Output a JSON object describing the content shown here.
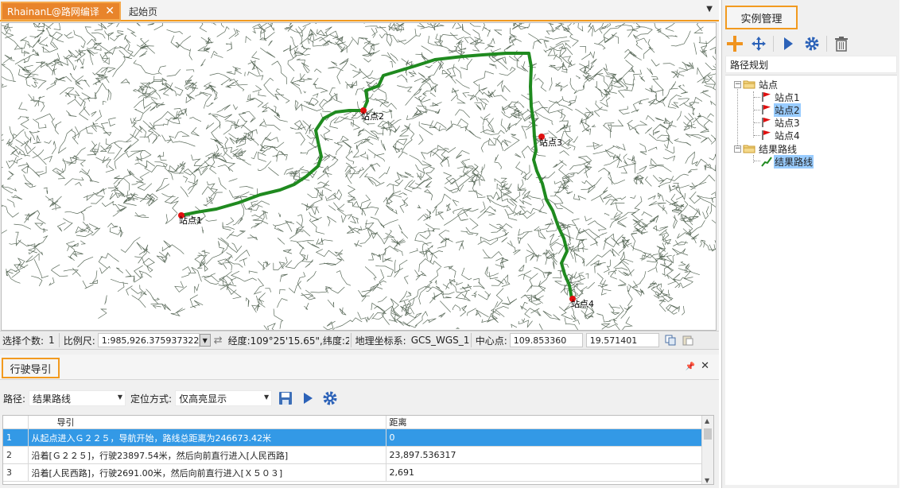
{
  "tabs": [
    {
      "label": "RhainanL@路网编译",
      "close": "✕",
      "active": true
    },
    {
      "label": "起始页",
      "active": false
    }
  ],
  "map": {
    "route_color": "#1f8a1f",
    "road_color": "#5a6a5a",
    "station_color": "#e01010",
    "stations": [
      "站点1",
      "站点2",
      "站点3",
      "站点4"
    ]
  },
  "statusbar": {
    "selection_label": "选择个数:",
    "selection_value": "1",
    "scale_label": "比例尺:",
    "scale_value": "1:985,926.375937322",
    "coords_label": "经度:109°25'15.65\",纬度:2...",
    "crs_label": "地理坐标系:",
    "crs_value": "GCS_WGS_1...",
    "center_label": "中心点:",
    "center_x": "109.853360",
    "center_y": "19.571401"
  },
  "navigation": {
    "title": "行驶导引",
    "path_label": "路径:",
    "path_value": "结果路线",
    "locate_label": "定位方式:",
    "locate_value": "仅高亮显示",
    "columns": [
      "导引",
      "距离"
    ],
    "rows": [
      {
        "index": "1",
        "guide": "从起点进入Ｇ２２５，导航开始，路线总距离为246673.42米",
        "distance": "0"
      },
      {
        "index": "2",
        "guide": "沿着[Ｇ２２５]，行驶23897.54米，然后向前直行进入[人民西路]",
        "distance": "23,897.536317"
      },
      {
        "index": "3",
        "guide": "沿着[人民西路]，行驶2691.00米，然后向前直行进入[Ｘ５０３]",
        "distance": "2,691"
      }
    ]
  },
  "instance_panel": {
    "title": "实例管理",
    "combo_value": "路径规划",
    "tree": {
      "stations_group": "站点",
      "stations": [
        "站点1",
        "站点2",
        "站点3",
        "站点4"
      ],
      "route_group": "结果路线",
      "route_item": "结果路线"
    }
  }
}
